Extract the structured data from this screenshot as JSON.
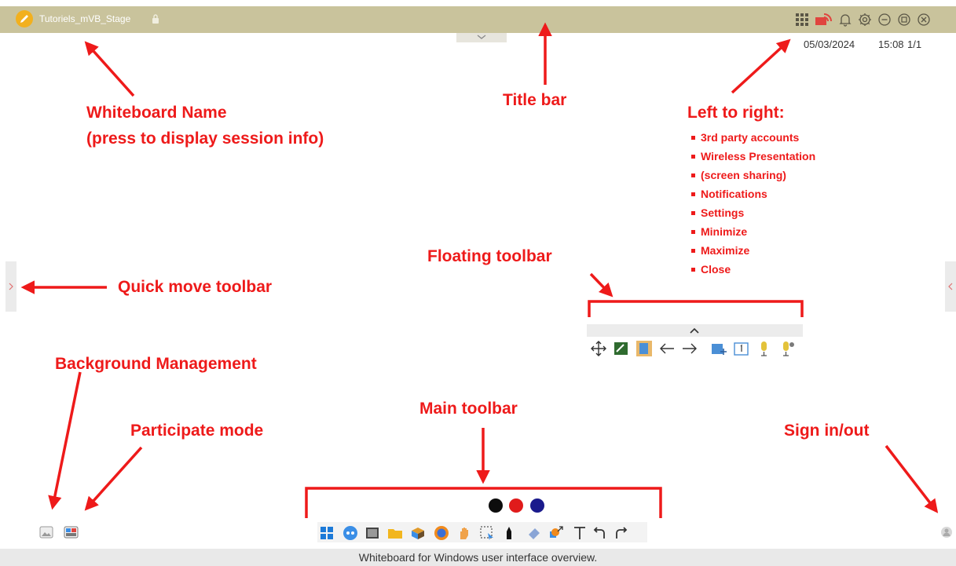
{
  "title_bar": {
    "whiteboard_name": "Tutoriels_mVB_Stage",
    "icons": [
      "edit-pencil-icon",
      "lock-icon",
      "apps-grid-icon",
      "wireless-presentation-icon",
      "bell-icon",
      "gear-icon",
      "minimize-icon",
      "maximize-icon",
      "close-icon"
    ]
  },
  "status": {
    "date": "05/03/2024",
    "time": "15:08",
    "page": "1/1"
  },
  "annotations": {
    "whiteboard_name_line1": "Whiteboard Name",
    "whiteboard_name_line2": "(press to display session info)",
    "title_bar": "Title bar",
    "left_to_right": "Left to right:",
    "right_items": [
      "3rd party accounts",
      "Wireless Presentation",
      "(screen sharing)",
      "Notifications",
      "Settings",
      "Minimize",
      "Maximize",
      "Close"
    ],
    "floating_toolbar": "Floating toolbar",
    "quick_move_toolbar": "Quick move toolbar",
    "background_management": "Background Management",
    "participate_mode": "Participate mode",
    "main_toolbar": "Main toolbar",
    "sign_in_out": "Sign in/out"
  },
  "floating_toolbar": {
    "icons": [
      "move-icon",
      "green-board-icon",
      "page-icon",
      "arrow-left-icon",
      "arrow-right-icon",
      "add-page-icon",
      "page-number-icon",
      "mic-icon",
      "mic-settings-icon"
    ]
  },
  "main_toolbar": {
    "colors": [
      "#0d0d0d",
      "#e01b1b",
      "#1a1a8c"
    ],
    "icons": [
      "windows-icon",
      "browser-icon",
      "screenshot-icon",
      "folder-icon",
      "apps-box-icon",
      "firefox-icon",
      "hand-icon",
      "select-icon",
      "pen-icon",
      "eraser-icon",
      "shapes-icon",
      "text-icon",
      "undo-icon",
      "redo-icon"
    ]
  },
  "caption": "Whiteboard for Windows user interface overview.",
  "colors": {
    "annotation": "#ee1a1a",
    "title_bar": "#c9c39c"
  }
}
